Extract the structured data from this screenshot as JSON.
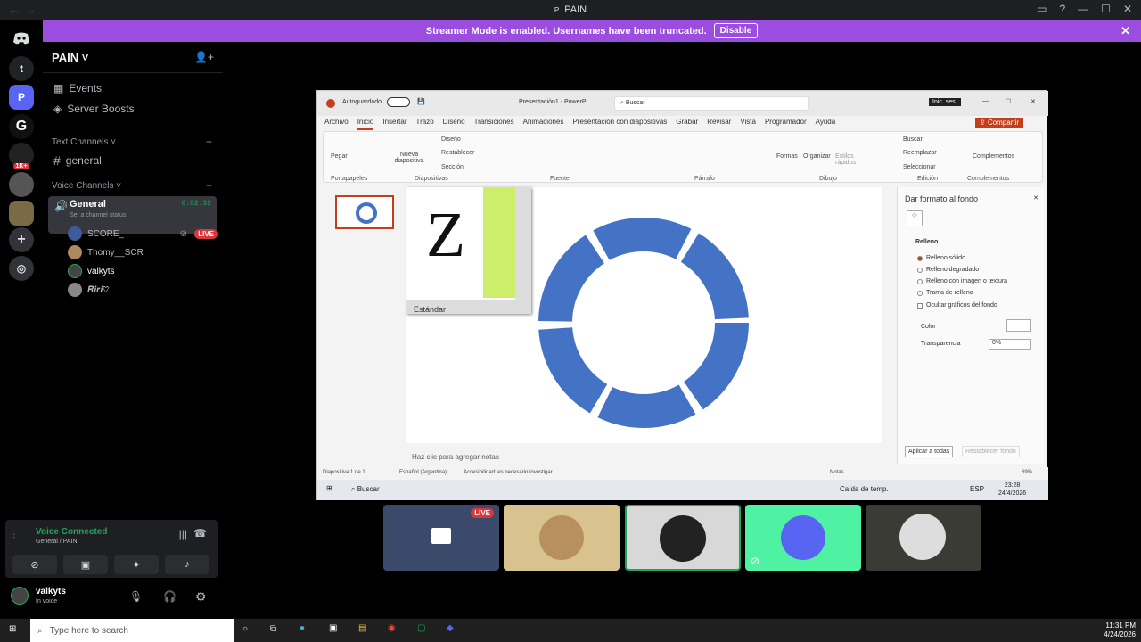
{
  "window": {
    "title": "PAIN"
  },
  "banner": {
    "text": "Streamer Mode is enabled. Usernames have been truncated.",
    "button": "Disable"
  },
  "servers": [
    {
      "label": "t"
    },
    {
      "label": "P"
    },
    {
      "label": "1K+"
    }
  ],
  "sidebar": {
    "server_name": "PAIN",
    "events": "Events",
    "boosts": "Server Boosts",
    "text_cat": "Text Channels",
    "text_channel": "general",
    "voice_cat": "Voice Channels",
    "voice_channel": "General",
    "voice_time": "6:02:32",
    "status_placeholder": "Set a channel status",
    "members": [
      {
        "name": "SCORE_",
        "live": "LIVE"
      },
      {
        "name": "Thomy__SCR"
      },
      {
        "name": "valkyts"
      },
      {
        "name": "𝑹𝒊𝒓𝒊♡"
      }
    ]
  },
  "voice_panel": {
    "status": "Voice Connected",
    "location": "General / PAIN"
  },
  "user": {
    "name": "valkyts",
    "status": "In voice"
  },
  "ppt": {
    "autosave": "Autoguardado",
    "file": "Presentación1 - PowerP...",
    "search": "Buscar",
    "signin": "Inic. ses.",
    "tabs": [
      "Archivo",
      "Inicio",
      "Insertar",
      "Trazo",
      "Diseño",
      "Transiciones",
      "Animaciones",
      "Presentación con diapositivas",
      "Grabar",
      "Revisar",
      "Vista",
      "Programador",
      "Ayuda"
    ],
    "share": "Compartir",
    "groups": [
      "Portapapeles",
      "Diapositivas",
      "Fuente",
      "Párrafo",
      "Dibujo",
      "Edición",
      "Complementos"
    ],
    "ribbon_buttons": {
      "pegar": "Pegar",
      "nueva": "Nueva diapositiva",
      "diseno": "Diseño",
      "restablecer": "Restablecer",
      "seccion": "Sección",
      "formas": "Formas",
      "organizar": "Organizar",
      "estilos": "Estilos rápidos",
      "buscar": "Buscar",
      "reemplazar": "Reemplazar",
      "seleccionar": "Seleccionar",
      "complementos": "Complementos"
    },
    "layout_label": "Estándar",
    "notes_placeholder": "Haz clic para agregar notas",
    "panel": {
      "title": "Dar formato al fondo",
      "section": "Relleno",
      "options": [
        "Relleno sólido",
        "Relleno degradado",
        "Relleno con imagen o textura",
        "Trama de relleno"
      ],
      "hide": "Ocultar gráficos del fondo",
      "color": "Color",
      "transparency": "Transparencia",
      "transparency_value": "0%",
      "apply": "Aplicar a todas",
      "reset": "Restablecer fondo"
    },
    "status": {
      "slide": "Diapositiva 1 de 1",
      "lang": "Español (Argentina)",
      "access": "Accesibilidad: es necesario investigar",
      "notes": "Notas",
      "zoom": "69%"
    },
    "win": {
      "search": "Buscar",
      "weather": "Caída de temp.",
      "lang": "ESP",
      "time": "23:28",
      "date": "24/4/2026"
    }
  },
  "taskbar": {
    "search": "Type here to search",
    "time": "11:31 PM",
    "date": "4/24/2026"
  },
  "colors": {
    "accent": "#9b4de0",
    "donut": "#4472c4",
    "green": "#23a559"
  }
}
